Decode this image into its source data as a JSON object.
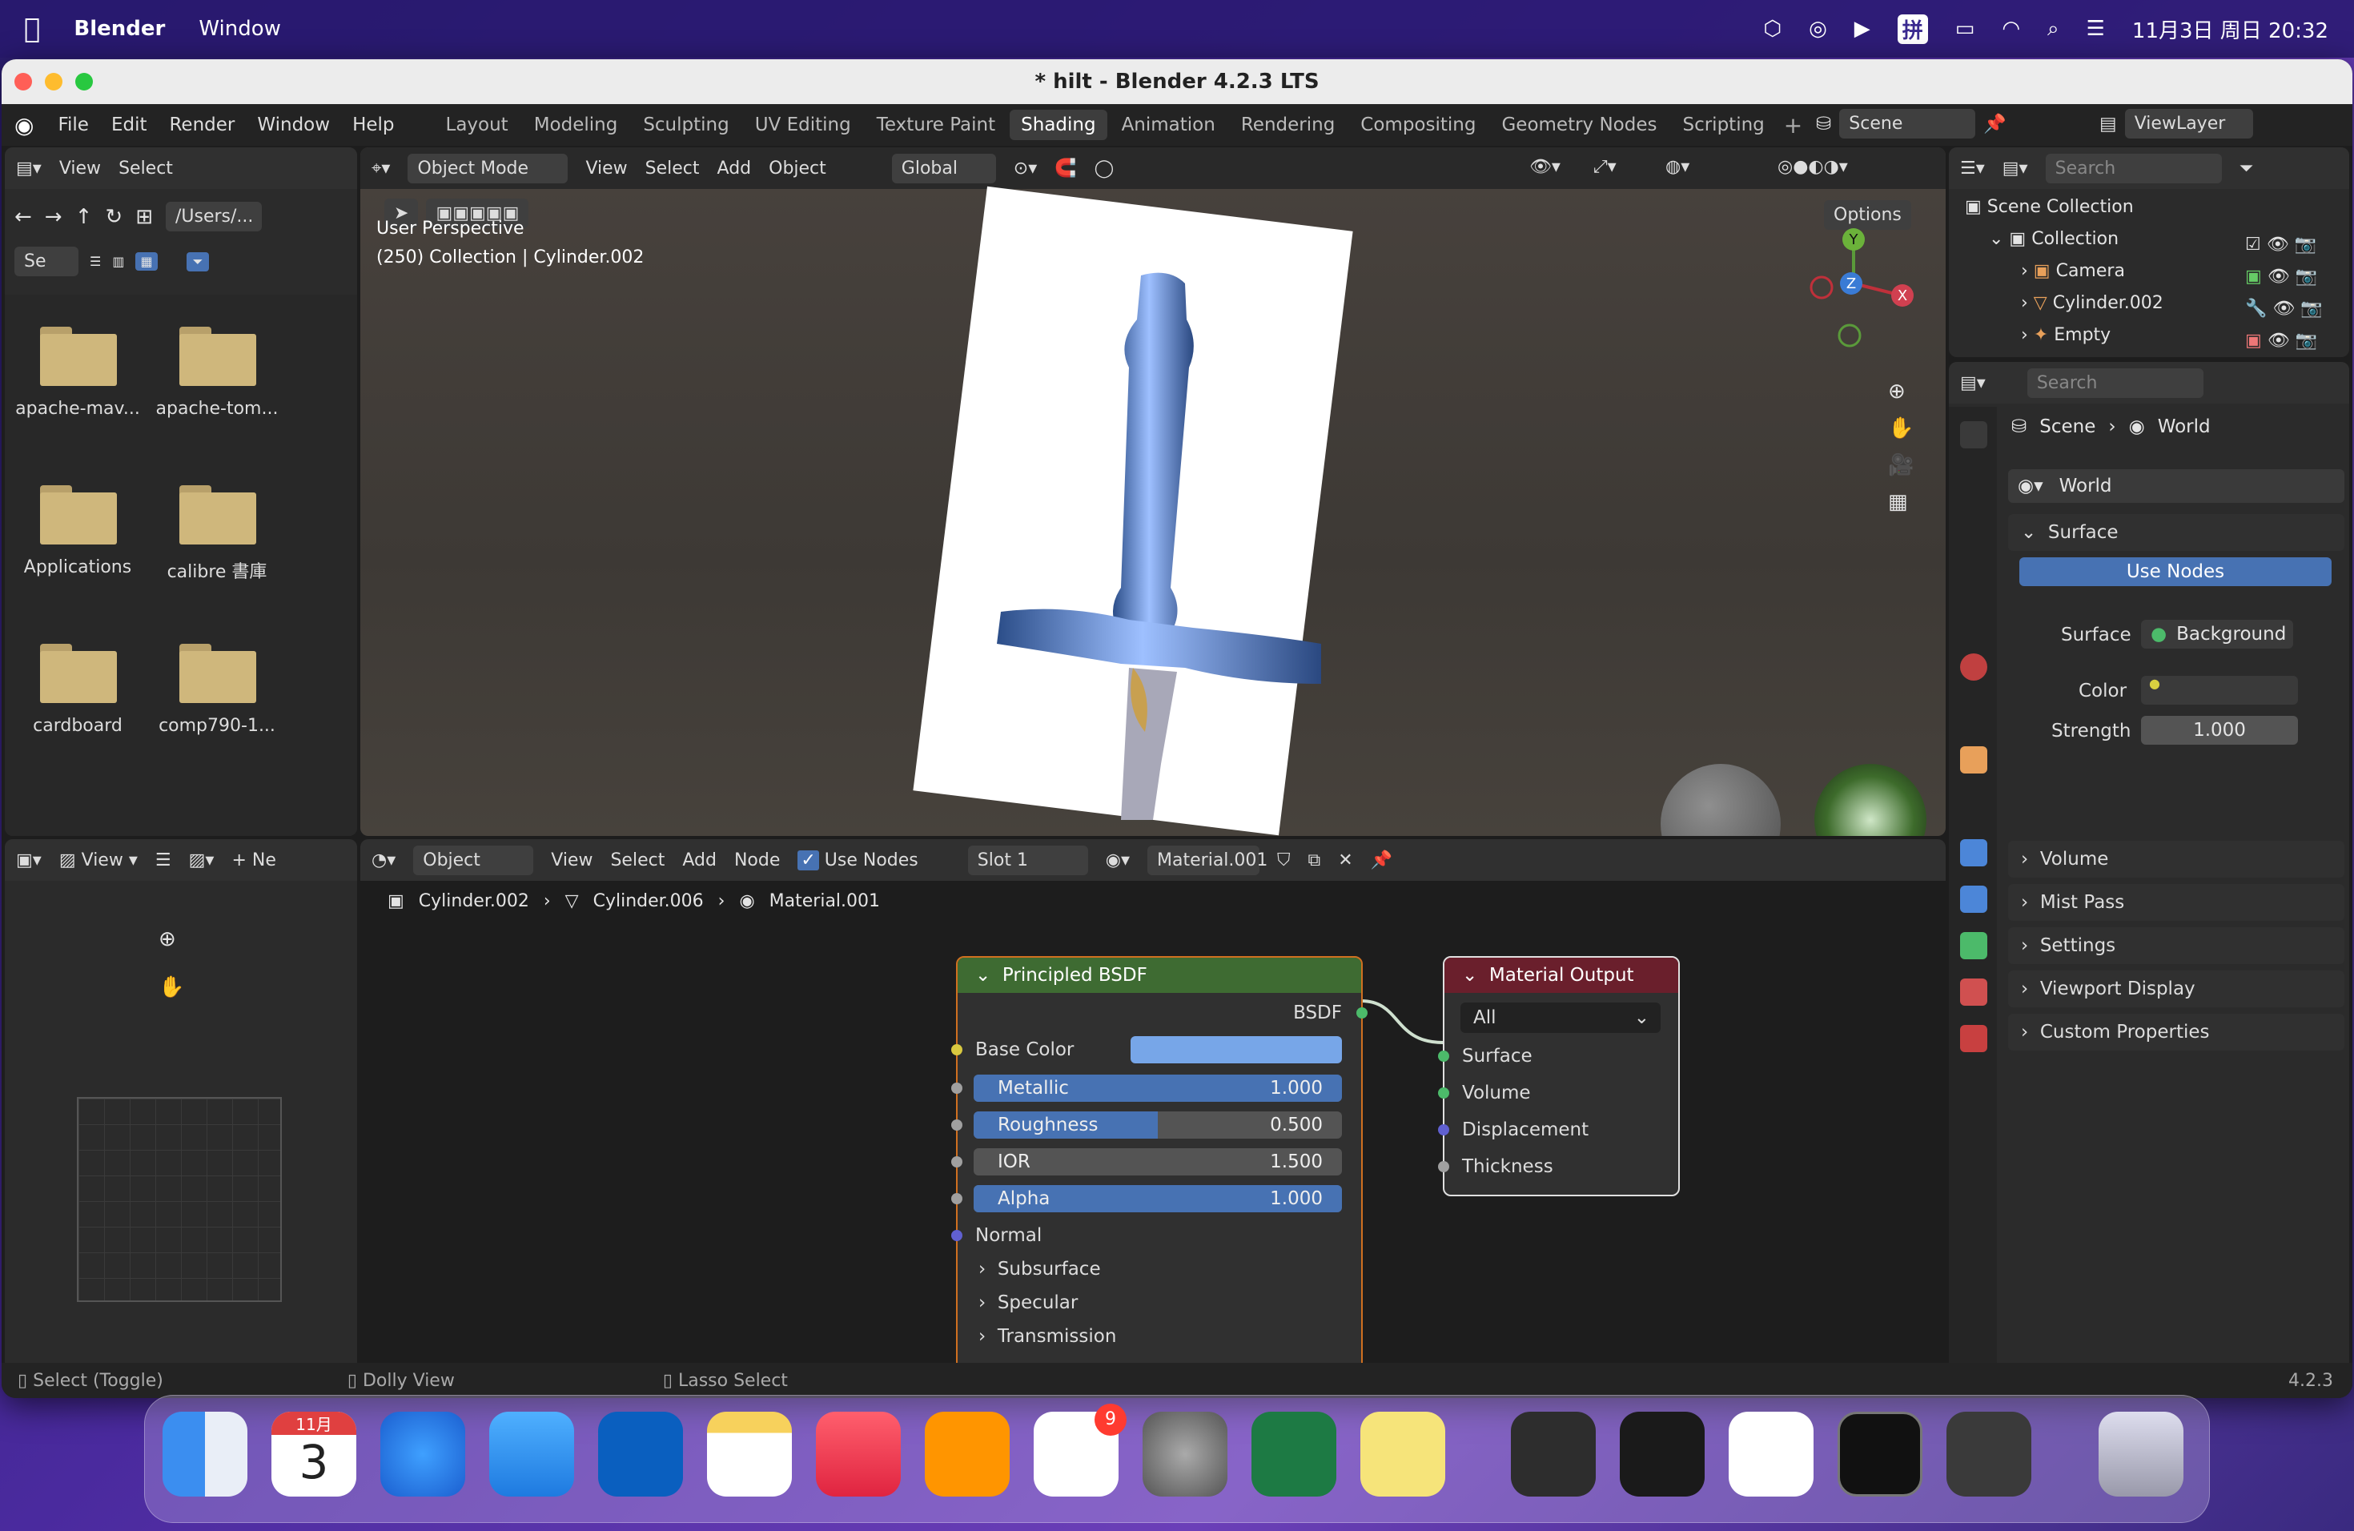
{
  "menubar": {
    "app": "Blender",
    "items": [
      "Window"
    ],
    "datetime": "11月3日 周日 20:32"
  },
  "window": {
    "title": "* hilt - Blender 4.2.3 LTS"
  },
  "topbar": {
    "menus": [
      "File",
      "Edit",
      "Render",
      "Window",
      "Help"
    ],
    "workspaces": [
      "Layout",
      "Modeling",
      "Sculpting",
      "UV Editing",
      "Texture Paint",
      "Shading",
      "Animation",
      "Rendering",
      "Compositing",
      "Geometry Nodes",
      "Scripting"
    ],
    "active_workspace": "Shading",
    "scene": "Scene",
    "viewlayer": "ViewLayer"
  },
  "filebrowser": {
    "menus": [
      "View",
      "Select"
    ],
    "path": "/Users/...",
    "search": "Se",
    "items": [
      "apache-mav...",
      "apache-tom...",
      "Applications",
      "calibre 書庫",
      "cardboard",
      "comp790-1..."
    ]
  },
  "viewport": {
    "mode": "Object Mode",
    "menus": [
      "View",
      "Select",
      "Add",
      "Object"
    ],
    "transform": "Global",
    "options": "Options",
    "info_line1": "User Perspective",
    "info_line2": "(250) Collection | Cylinder.002",
    "gizmo": {
      "y": "Y",
      "z": "Z",
      "x": "X"
    }
  },
  "outliner": {
    "search": "Search",
    "root": "Scene Collection",
    "collection": "Collection",
    "items": [
      {
        "name": "Camera"
      },
      {
        "name": "Cylinder.002"
      },
      {
        "name": "Empty"
      }
    ]
  },
  "properties": {
    "search": "Search",
    "breadcrumb": [
      "Scene",
      "World"
    ],
    "world_name": "World",
    "surface_section": "Surface",
    "use_nodes": "Use Nodes",
    "surface_label": "Surface",
    "surface_value": "Background",
    "color_label": "Color",
    "strength_label": "Strength",
    "strength_value": "1.000",
    "sections": [
      "Volume",
      "Mist Pass",
      "Settings",
      "Viewport Display",
      "Custom Properties"
    ]
  },
  "image_editor": {
    "view": "View",
    "new": "Ne"
  },
  "node_editor": {
    "type": "Object",
    "menus": [
      "View",
      "Select",
      "Add",
      "Node"
    ],
    "use_nodes": "Use Nodes",
    "slot": "Slot 1",
    "material": "Material.001",
    "breadcrumb": [
      "Cylinder.002",
      "Cylinder.006",
      "Material.001"
    ]
  },
  "principled": {
    "title": "Principled BSDF",
    "output": "BSDF",
    "base_color": "Base Color",
    "fields": [
      {
        "label": "Metallic",
        "value": "1.000",
        "fill": 1.0
      },
      {
        "label": "Roughness",
        "value": "0.500",
        "fill": 0.5
      },
      {
        "label": "IOR",
        "value": "1.500",
        "fill": 0.0
      },
      {
        "label": "Alpha",
        "value": "1.000",
        "fill": 1.0
      }
    ],
    "normal": "Normal",
    "panels": [
      "Subsurface",
      "Specular",
      "Transmission"
    ]
  },
  "material_output": {
    "title": "Material Output",
    "target": "All",
    "inputs": [
      "Surface",
      "Volume",
      "Displacement",
      "Thickness"
    ]
  },
  "statusbar": {
    "select": "Select (Toggle)",
    "dolly": "Dolly View",
    "lasso": "Lasso Select",
    "version": "4.2.3"
  },
  "dock": {
    "calendar_month": "11月",
    "calendar_day": "3",
    "reminders_badge": "9"
  },
  "colors": {
    "accent": "#4772b3",
    "principled_header": "#3e6b32",
    "output_header": "#6a1f2c",
    "base_color": "#77a6e8"
  }
}
